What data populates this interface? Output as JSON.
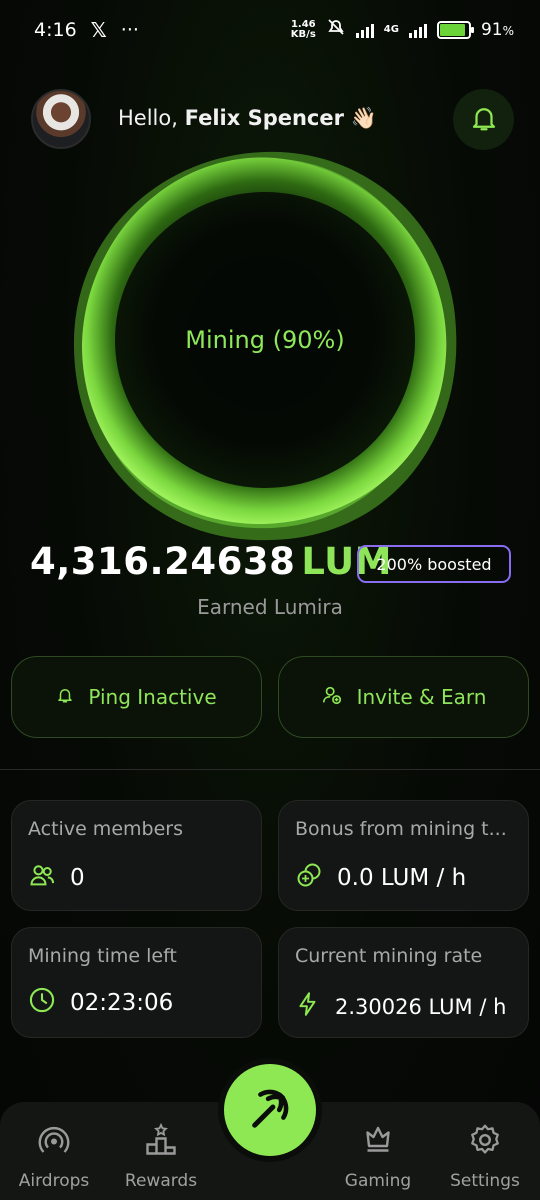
{
  "status": {
    "time": "4:16",
    "speed_value": "1.46",
    "speed_unit": "KB/s",
    "network": "4G",
    "battery": "91",
    "battery_unit": "%"
  },
  "header": {
    "greeting": "Hello,",
    "user_name": "Felix Spencer",
    "wave": "👋🏻"
  },
  "mining": {
    "label": "Mining (90%)",
    "progress": 0.9
  },
  "balance": {
    "amount": "4,316.24638",
    "unit": "LUM",
    "boost": "200% boosted",
    "caption": "Earned Lumira"
  },
  "actions": {
    "ping": "Ping Inactive",
    "invite": "Invite & Earn"
  },
  "stats": [
    {
      "title": "Active members",
      "value": "0",
      "icon": "users-icon"
    },
    {
      "title": "Bonus from mining t...",
      "value": "0.0 LUM / h",
      "icon": "coins-icon"
    },
    {
      "title": "Mining time left",
      "value": "02:23:06",
      "icon": "clock-icon"
    },
    {
      "title": "Current mining rate",
      "value": "2.30026 LUM / h",
      "icon": "lightning-icon"
    }
  ],
  "nav": {
    "airdrops": "Airdrops",
    "rewards": "Rewards",
    "gaming": "Gaming",
    "settings": "Settings"
  },
  "colors": {
    "accent": "#8ee853",
    "boost_border": "#8a6cf0"
  }
}
